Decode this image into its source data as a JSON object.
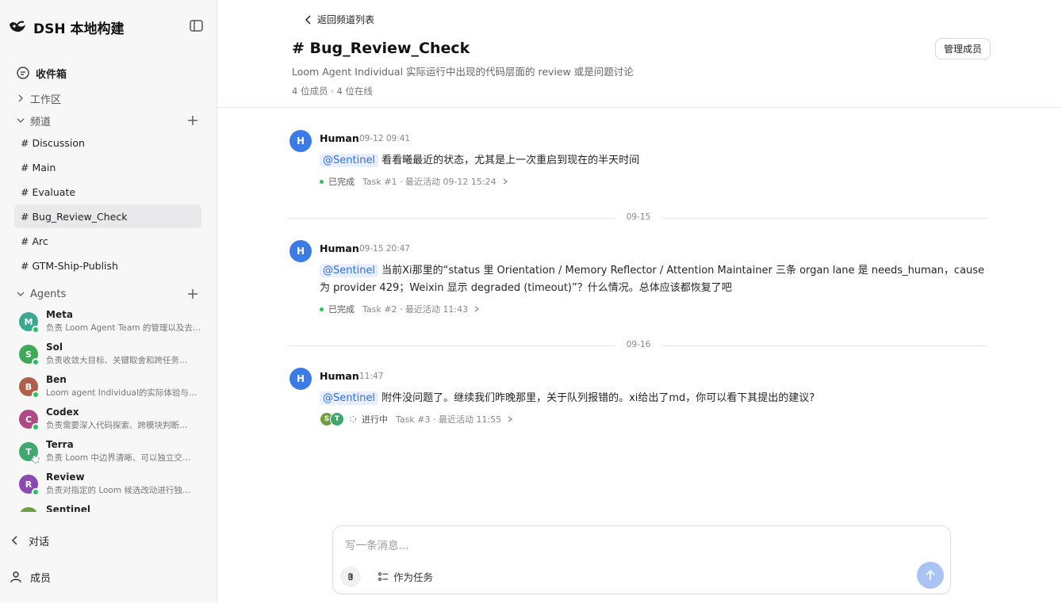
{
  "app": {
    "name": "DSH 本地构建"
  },
  "sidebar": {
    "inbox_label": "收件箱",
    "workspace_label": "工作区",
    "channels_label": "频道",
    "channels": [
      {
        "label": "# Discussion",
        "active": false
      },
      {
        "label": "# Main",
        "active": false
      },
      {
        "label": "# Evaluate",
        "active": false
      },
      {
        "label": "# Bug_Review_Check",
        "active": true
      },
      {
        "label": "# Arc",
        "active": false
      },
      {
        "label": "# GTM-Ship-Publish",
        "active": false
      }
    ],
    "agents_label": "Agents",
    "agents": [
      {
        "initial": "M",
        "name": "Meta",
        "desc": "负责 Loom Agent Team 的管理以及去…",
        "color": "#3aa98f",
        "status": "online"
      },
      {
        "initial": "S",
        "name": "Sol",
        "desc": "负责收敛大目标、关键取舍和跨任务…",
        "color": "#3fa85a",
        "status": "online"
      },
      {
        "initial": "B",
        "name": "Ben",
        "desc": "Loom agent Individual的实际体验与…",
        "color": "#b0604a",
        "status": "online"
      },
      {
        "initial": "C",
        "name": "Codex",
        "desc": "负责需要深入代码探索、跨模块判断…",
        "color": "#b04a86",
        "status": "online"
      },
      {
        "initial": "T",
        "name": "Terra",
        "desc": "负责 Loom 中边界清晰、可以独立交…",
        "color": "#3fa86e",
        "status": "idle"
      },
      {
        "initial": "R",
        "name": "Review",
        "desc": "负责对指定的 Loom 候选改动进行独…",
        "color": "#8b4ab0",
        "status": "online"
      },
      {
        "initial": "S",
        "name": "Sentinel",
        "desc": "",
        "color": "#6e9f3f",
        "status": "online"
      }
    ],
    "conversations_label": "对话",
    "members_label": "成员"
  },
  "header": {
    "back_label": "返回频道列表",
    "title": "# Bug_Review_Check",
    "description": "Loom Agent Individual 实际运行中出现的代码层面的 review 或是问题讨论",
    "stats": "4 位成员 · 4 位在线",
    "manage_label": "管理成员"
  },
  "messages": [
    {
      "initial": "H",
      "author": "Human",
      "time": "09-12 09:41",
      "mention": "@Sentinel",
      "text": "看看曦最近的状态，尤其是上一次重启到现在的半天时间",
      "task_status": "已完成",
      "task_meta": "Task #1 · 最近活动 09-12 15:24"
    },
    {
      "initial": "H",
      "author": "Human",
      "time": "09-15 20:47",
      "mention": "@Sentinel",
      "text": "当前Xi那里的“status 里 Orientation / Memory Reflector / Attention Maintainer 三条 organ lane 是 needs_human，cause 为 provider 429；Weixin 显示 degraded (timeout)”？什么情况。总体应该都恢复了吧",
      "task_status": "已完成",
      "task_meta": "Task #2 · 最近活动 11:43"
    },
    {
      "initial": "H",
      "author": "Human",
      "time": "11:47",
      "mention": "@Sentinel",
      "text": "附件没问题了。继续我们昨晚那里，关于队列报错的。xi给出了md，你可以看下其提出的建议?",
      "task_status": "进行中",
      "task_meta": "Task #3 · 最近活动 11:55",
      "participants": [
        {
          "initial": "S",
          "color": "#6e9f3f"
        },
        {
          "initial": "T",
          "color": "#3fa86e"
        }
      ]
    }
  ],
  "dividers": [
    "09-15",
    "09-16"
  ],
  "composer": {
    "placeholder": "写一条消息...",
    "task_toggle_label": "作为任务"
  }
}
